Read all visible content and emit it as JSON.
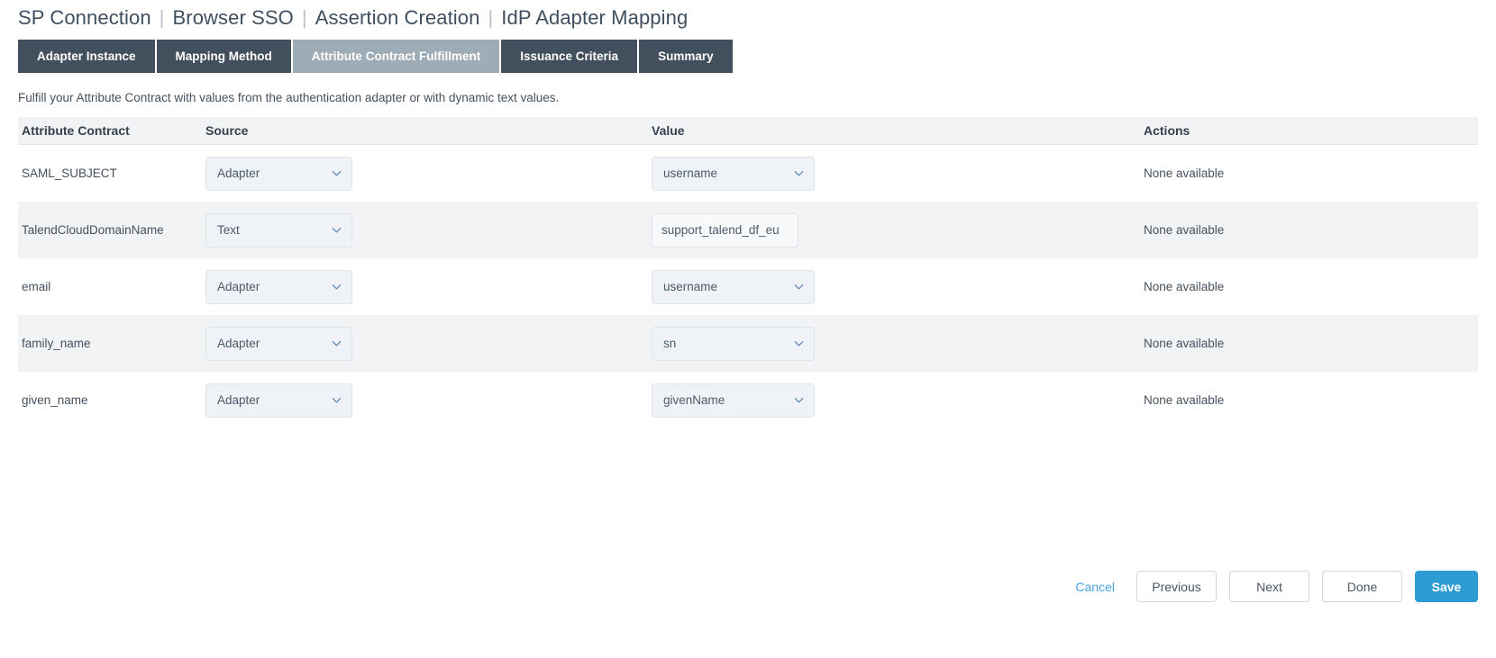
{
  "breadcrumb": {
    "separator": "|",
    "items": [
      "SP Connection",
      "Browser SSO",
      "Assertion Creation",
      "IdP Adapter Mapping"
    ]
  },
  "tabs": [
    {
      "label": "Adapter Instance",
      "active": false
    },
    {
      "label": "Mapping Method",
      "active": false
    },
    {
      "label": "Attribute Contract Fulfillment",
      "active": true
    },
    {
      "label": "Issuance Criteria",
      "active": false
    },
    {
      "label": "Summary",
      "active": false
    }
  ],
  "intro": "Fulfill your Attribute Contract with values from the authentication adapter or with dynamic text values.",
  "table": {
    "headers": {
      "attribute_contract": "Attribute Contract",
      "source": "Source",
      "value": "Value",
      "actions": "Actions"
    },
    "rows": [
      {
        "attribute": "SAML_SUBJECT",
        "source": "Adapter",
        "source_type": "select",
        "value": "username",
        "value_type": "select",
        "actions": "None available"
      },
      {
        "attribute": "TalendCloudDomainName",
        "source": "Text",
        "source_type": "select",
        "value": "support_talend_df_eu",
        "value_type": "text",
        "actions": "None available"
      },
      {
        "attribute": "email",
        "source": "Adapter",
        "source_type": "select",
        "value": "username",
        "value_type": "select",
        "actions": "None available"
      },
      {
        "attribute": "family_name",
        "source": "Adapter",
        "source_type": "select",
        "value": "sn",
        "value_type": "select",
        "actions": "None available"
      },
      {
        "attribute": "given_name",
        "source": "Adapter",
        "source_type": "select",
        "value": "givenName",
        "value_type": "select",
        "actions": "None available"
      }
    ]
  },
  "footer": {
    "cancel": "Cancel",
    "previous": "Previous",
    "next": "Next",
    "done": "Done",
    "save": "Save"
  },
  "colors": {
    "tab_inactive_bg": "#41505c",
    "tab_active_bg": "#9eacb8",
    "table_header_bg": "#f1f3f5",
    "row_alt_bg": "#f1f3f5",
    "control_bg": "#eff3f7",
    "link": "#4aa3df",
    "primary": "#2d9cd4",
    "text": "#45515e"
  }
}
